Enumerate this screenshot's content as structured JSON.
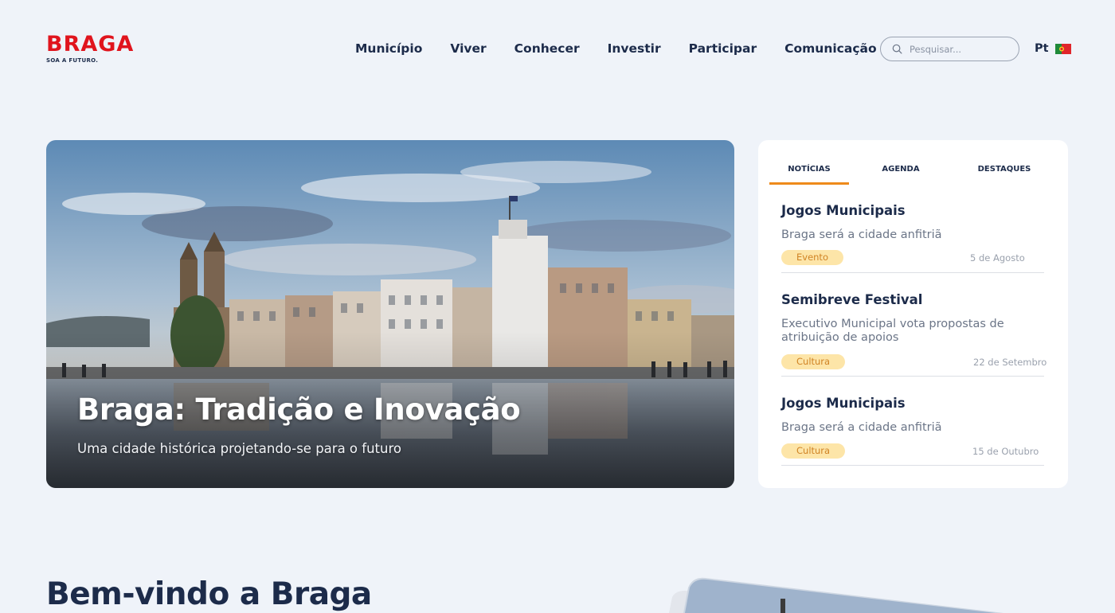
{
  "brand": {
    "logo_text": "BRAGA",
    "tagline": "SOA A FUTURO.",
    "color": "#e0141d"
  },
  "nav": {
    "items": [
      {
        "label": "Município"
      },
      {
        "label": "Viver"
      },
      {
        "label": "Conhecer"
      },
      {
        "label": "Investir"
      },
      {
        "label": "Participar"
      },
      {
        "label": "Comunicação"
      }
    ]
  },
  "search": {
    "placeholder": "Pesquisar...",
    "icon": "search-icon"
  },
  "language": {
    "label": "Pt",
    "flag_icon": "portugal-flag-icon"
  },
  "hero": {
    "title": "Braga: Tradição e Inovação",
    "subtitle": "Uma cidade histórica projetando-se para o futuro"
  },
  "news_panel": {
    "tabs": [
      {
        "label": "NOTÍCIAS",
        "active": true
      },
      {
        "label": "AGENDA",
        "active": false
      },
      {
        "label": "DESTAQUES",
        "active": false
      }
    ],
    "items": [
      {
        "title": "Jogos Municipais",
        "description": "Braga será a cidade anfitriã",
        "tag": "Evento",
        "date": "5 de Agosto"
      },
      {
        "title": "Semibreve Festival",
        "description": "Executivo Municipal vota propostas de atribuição de apoios",
        "tag": "Cultura",
        "date": "22 de Setembro"
      },
      {
        "title": "Jogos Municipais",
        "description": "Braga será a cidade anfitriã",
        "tag": "Cultura",
        "date": "15 de Outubro"
      }
    ]
  },
  "welcome": {
    "title": "Bem-vindo a Braga"
  },
  "colors": {
    "background": "#eff3f9",
    "primary_text": "#1c2b4a",
    "accent": "#ee8a1b",
    "badge_bg": "#fde5a8",
    "badge_text": "#d08324"
  }
}
